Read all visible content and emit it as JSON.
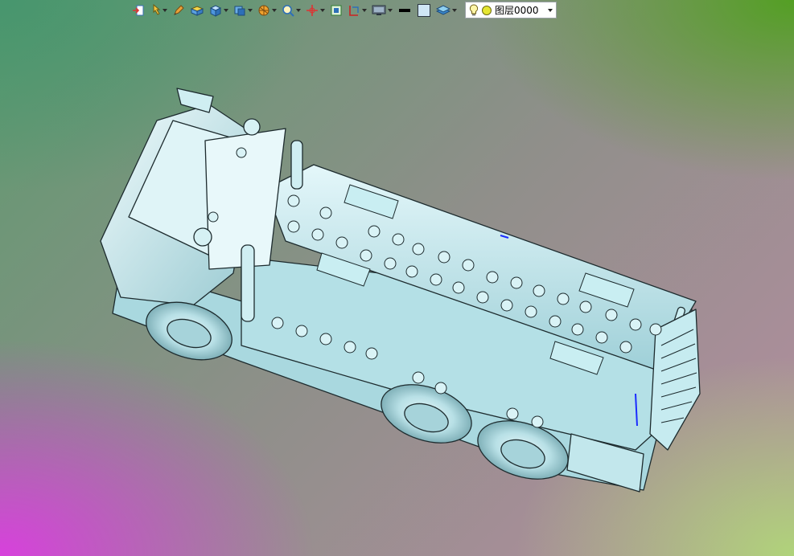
{
  "toolbar": {
    "buttons": [
      {
        "name": "import-icon",
        "dropdown": false
      },
      {
        "name": "pointer-light-icon",
        "dropdown": true
      },
      {
        "name": "sketch-pen-icon",
        "dropdown": false
      },
      {
        "name": "box-solid-icon",
        "dropdown": false
      },
      {
        "name": "cube-view-icon",
        "dropdown": true
      },
      {
        "name": "view-orientation-icon",
        "dropdown": true
      },
      {
        "name": "render-sphere-icon",
        "dropdown": true
      },
      {
        "name": "zoom-fit-icon",
        "dropdown": true
      },
      {
        "name": "pan-axis-icon",
        "dropdown": true
      },
      {
        "name": "frame-select-icon",
        "dropdown": false
      },
      {
        "name": "section-plane-icon",
        "dropdown": true
      },
      {
        "name": "display-monitor-icon",
        "dropdown": true
      },
      {
        "name": "line-color-swatch",
        "dropdown": false
      },
      {
        "name": "fill-color-swatch",
        "dropdown": false
      },
      {
        "name": "layer-stack-icon",
        "dropdown": true
      }
    ],
    "layer": {
      "label": "图层0000",
      "light_icon": "lightbulb-icon",
      "color_icon": "layer-color-dot"
    }
  },
  "colors": {
    "model_fill": "#bfe9ef",
    "model_shade": "#8fc4cc",
    "model_edge": "#1d2b2e",
    "layer_dot": "#e5e632"
  }
}
